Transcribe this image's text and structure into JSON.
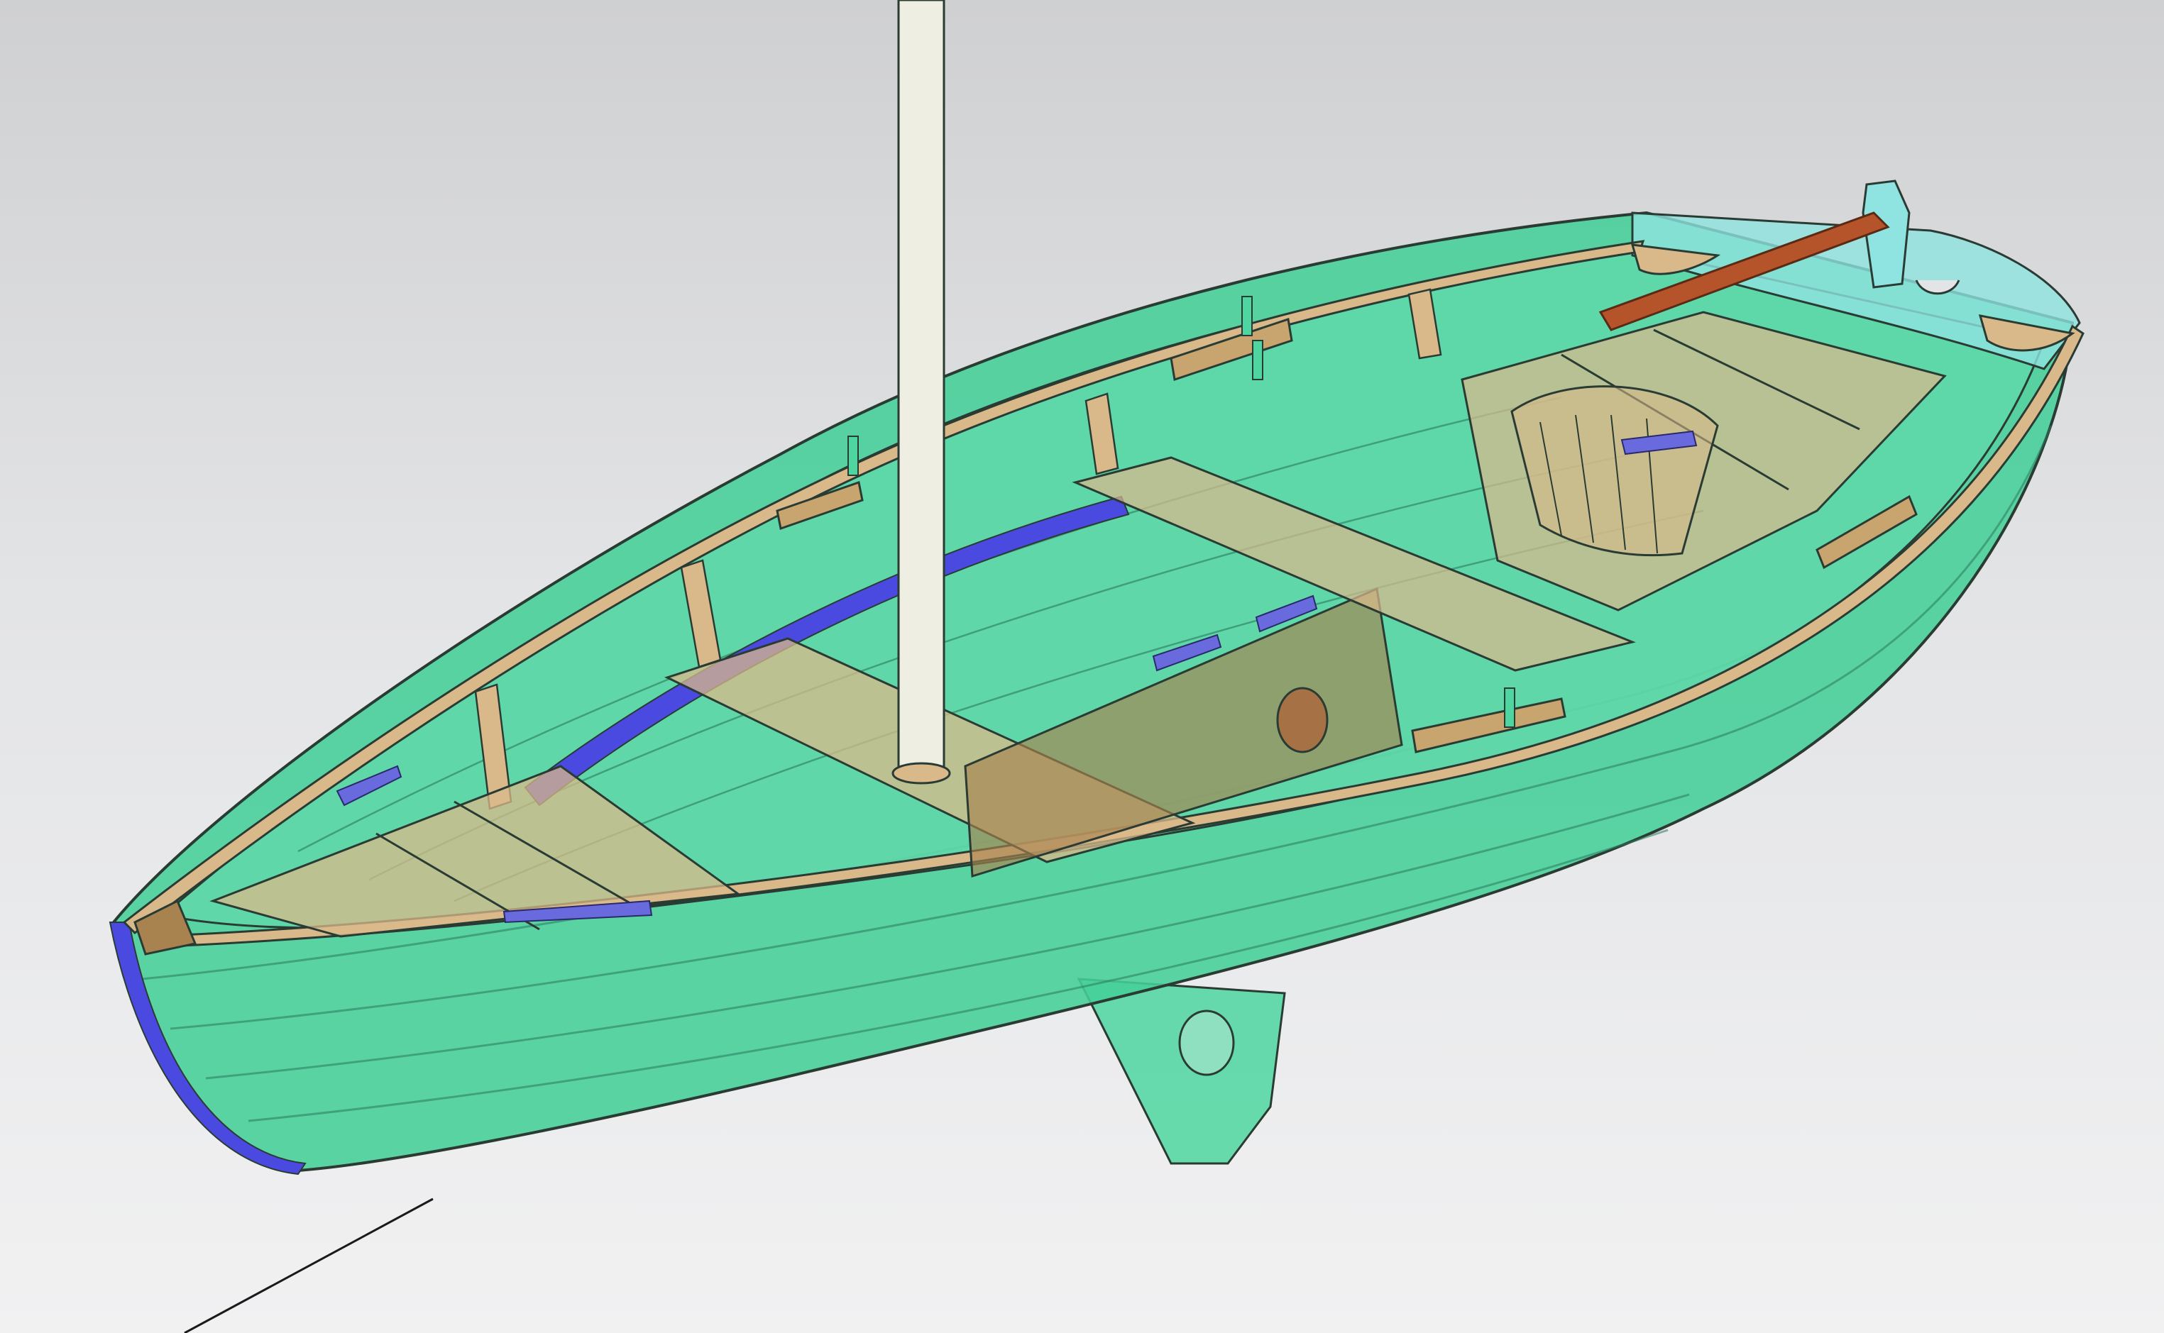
{
  "scene": {
    "subject": "boat-cad-model",
    "colors": {
      "background_top": "#cfd0d2",
      "background_bottom": "#f1f1f2",
      "hull": "#4fd6a0",
      "hull_dark": "#2fae7e",
      "interior": "#67d9b0",
      "wood": "#d9b98a",
      "wood_dark": "#a8834f",
      "gunwale": "#c8a46e",
      "glass": "#8fe3e0",
      "cleat": "#6a6adf",
      "blue_strip": "#4a4ae0",
      "mast": "#efeee2",
      "tiller": "#b5532a",
      "outline": "#2a3b33"
    },
    "icons": {
      "cleats": "cleat-icon",
      "oarlocks": "oarlock-icon"
    }
  }
}
